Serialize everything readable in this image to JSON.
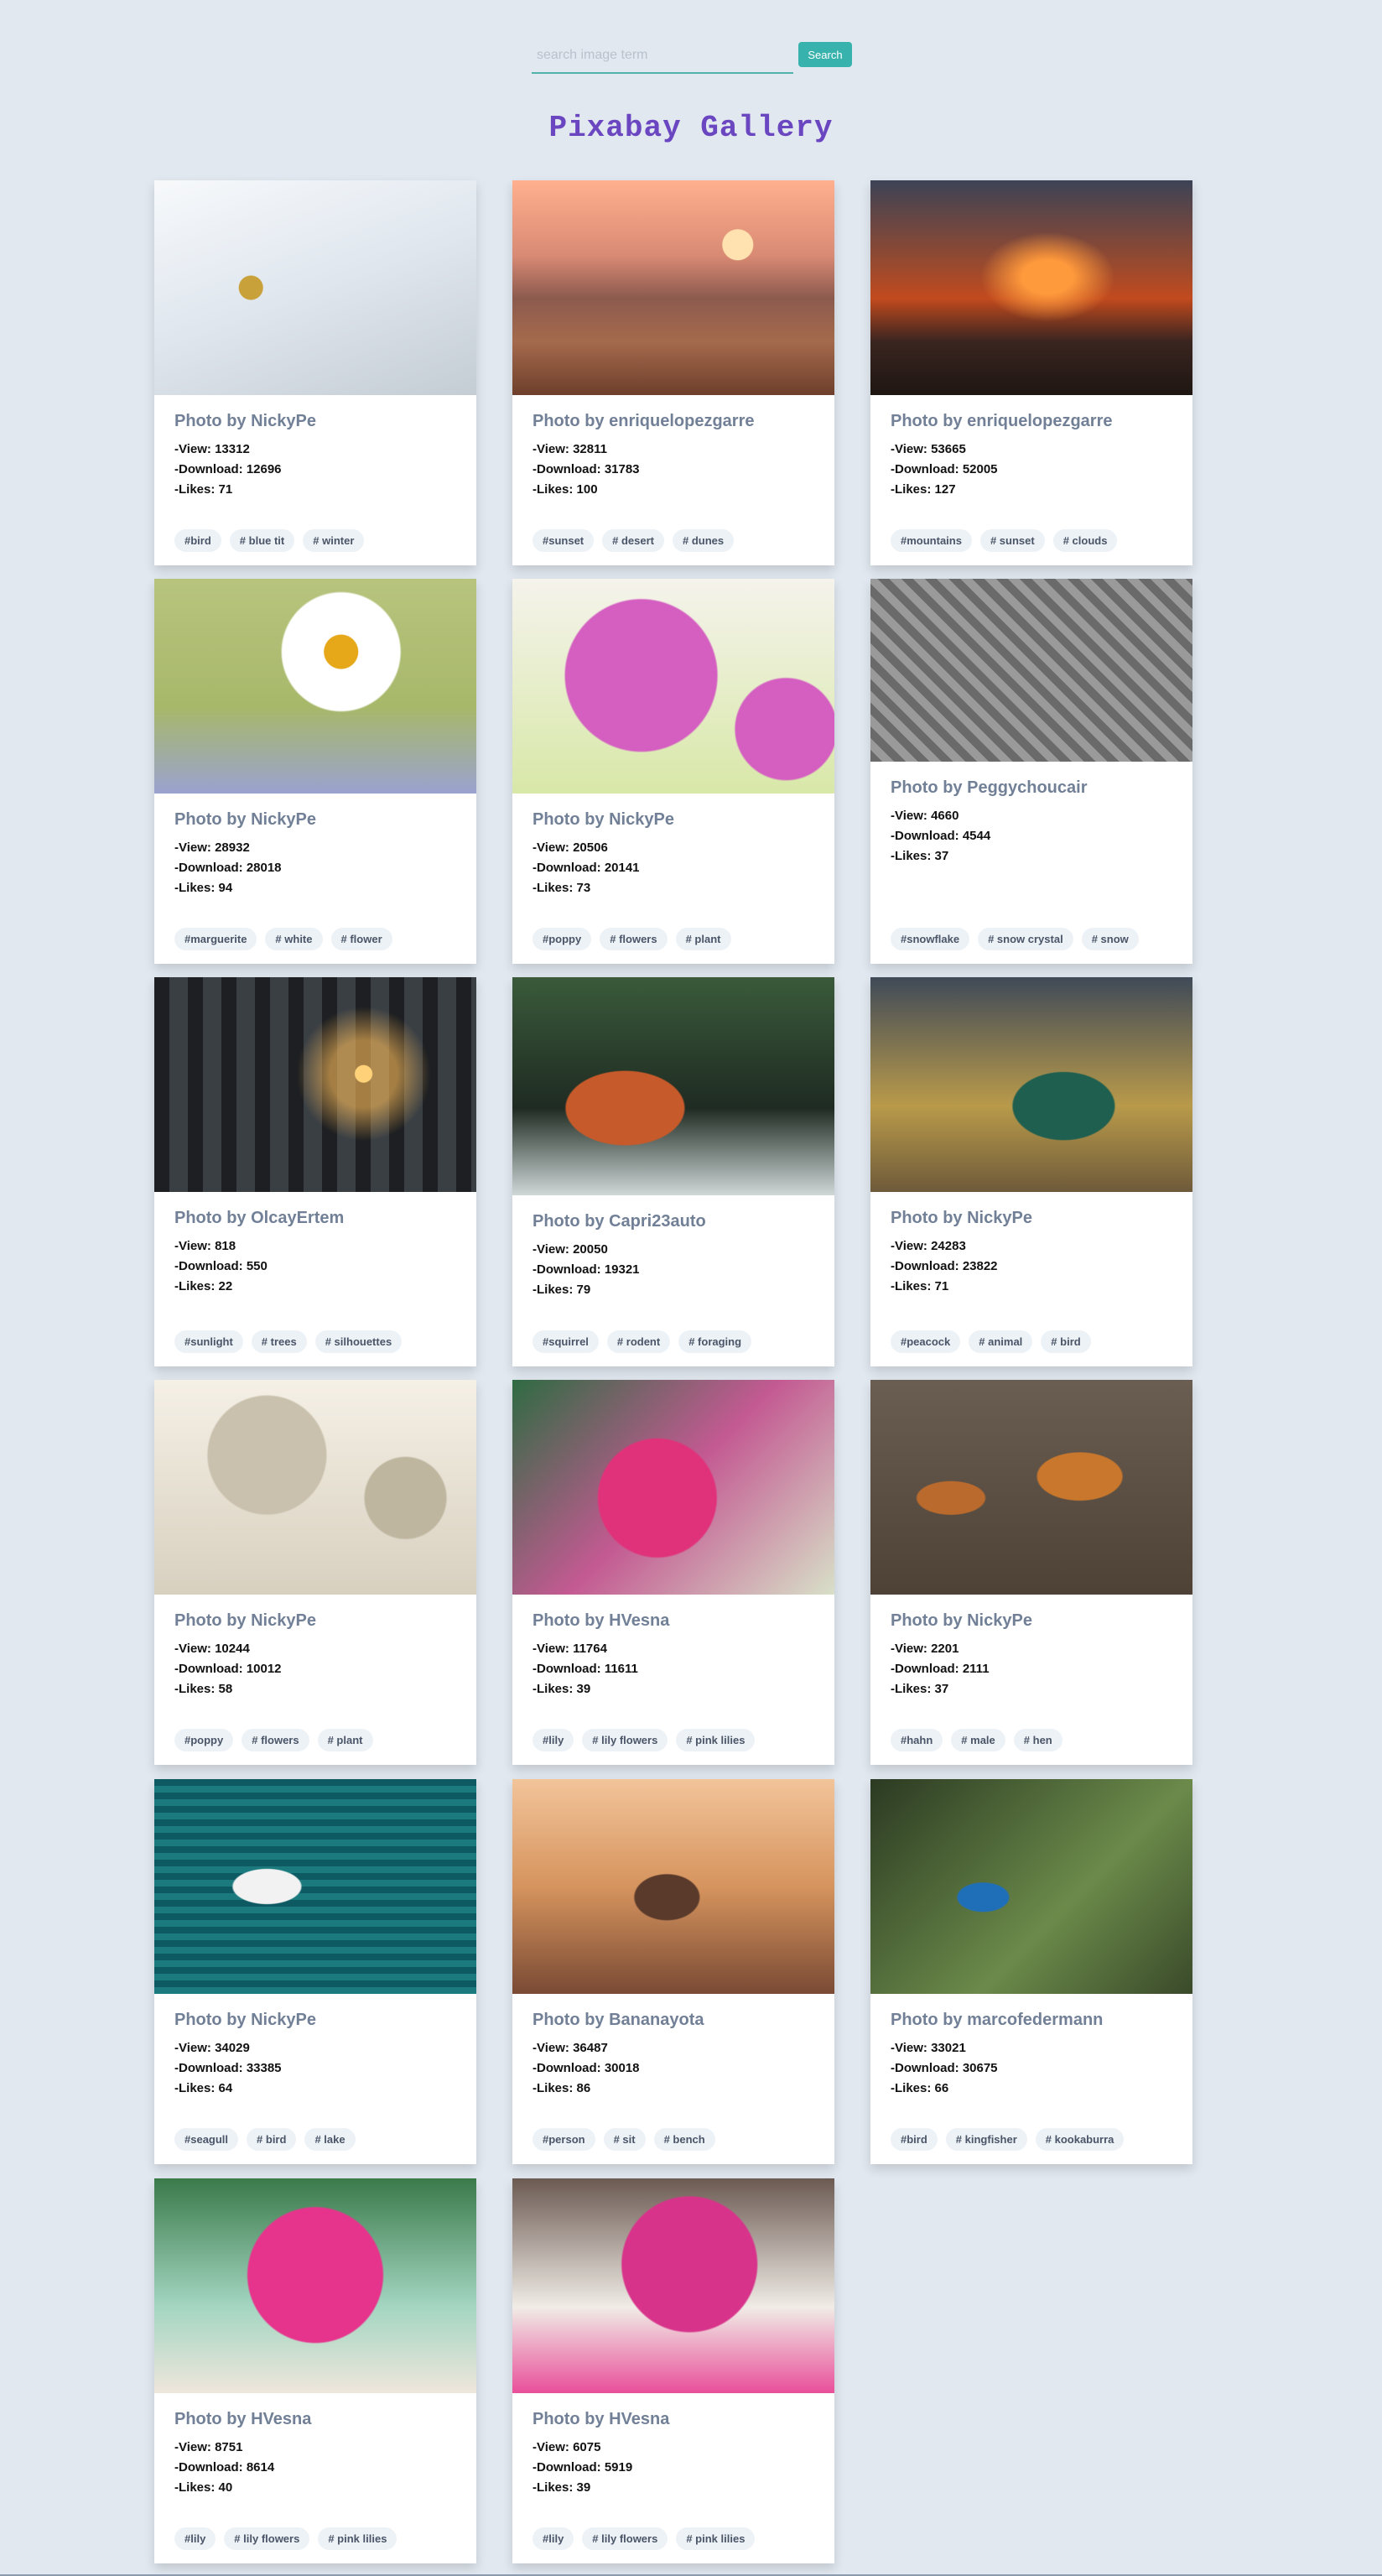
{
  "search": {
    "placeholder": "search image term",
    "button_label": "Search"
  },
  "title": "Pixabay Gallery",
  "colors": {
    "accent": "#38b2ac",
    "title": "#6b46c1",
    "background": "#e2e8f0"
  },
  "cards": [
    {
      "author": "Photo by NickyPe",
      "views": "-View: 13312",
      "downloads": "-Download: 12696",
      "likes": "-Likes: 71",
      "tags": [
        "#bird",
        "# blue tit",
        "# winter"
      ],
      "image": "bird-in-snowy-branches"
    },
    {
      "author": "Photo by enriquelopezgarre",
      "views": "-View: 32811",
      "downloads": "-Download: 31783",
      "likes": "-Likes: 100",
      "tags": [
        "#sunset",
        "# desert",
        "# dunes"
      ],
      "image": "desert-sunset"
    },
    {
      "author": "Photo by enriquelopezgarre",
      "views": "-View: 53665",
      "downloads": "-Download: 52005",
      "likes": "-Likes: 127",
      "tags": [
        "#mountains",
        "# sunset",
        "# clouds"
      ],
      "image": "mountain-sunset"
    },
    {
      "author": "Photo by NickyPe",
      "views": "-View: 28932",
      "downloads": "-Download: 28018",
      "likes": "-Likes: 94",
      "tags": [
        "#marguerite",
        "# white",
        "# flower"
      ],
      "image": "white-daisy"
    },
    {
      "author": "Photo by NickyPe",
      "views": "-View: 20506",
      "downloads": "-Download: 20141",
      "likes": "-Likes: 73",
      "tags": [
        "#poppy",
        "# flowers",
        "# plant"
      ],
      "image": "pink-poppies"
    },
    {
      "author": "Photo by Peggychoucair",
      "views": "-View: 4660",
      "downloads": "-Download: 4544",
      "likes": "-Likes: 37",
      "tags": [
        "#snowflake",
        "# snow crystal",
        "# snow"
      ],
      "image": "snowflake-on-knit"
    },
    {
      "author": "Photo by OlcayErtem",
      "views": "-View: 818",
      "downloads": "-Download: 550",
      "likes": "-Likes: 22",
      "tags": [
        "#sunlight",
        "# trees",
        "# silhouettes"
      ],
      "image": "forest-sunlight"
    },
    {
      "author": "Photo by Capri23auto",
      "views": "-View: 20050",
      "downloads": "-Download: 19321",
      "likes": "-Likes: 79",
      "tags": [
        "#squirrel",
        "# rodent",
        "# foraging"
      ],
      "image": "red-squirrel"
    },
    {
      "author": "Photo by NickyPe",
      "views": "-View: 24283",
      "downloads": "-Download: 23822",
      "likes": "-Likes: 71",
      "tags": [
        "#peacock",
        "# animal",
        "# bird"
      ],
      "image": "peacock"
    },
    {
      "author": "Photo by NickyPe",
      "views": "-View: 10244",
      "downloads": "-Download: 10012",
      "likes": "-Likes: 58",
      "tags": [
        "#poppy",
        "# flowers",
        "# plant"
      ],
      "image": "sepia-poppies"
    },
    {
      "author": "Photo by HVesna",
      "views": "-View: 11764",
      "downloads": "-Download: 11611",
      "likes": "-Likes: 39",
      "tags": [
        "#lily",
        "# lily flowers",
        "# pink lilies"
      ],
      "image": "pink-lily"
    },
    {
      "author": "Photo by NickyPe",
      "views": "-View: 2201",
      "downloads": "-Download: 2111",
      "likes": "-Likes: 37",
      "tags": [
        "#hahn",
        "# male",
        "# hen"
      ],
      "image": "rooster-and-hen"
    },
    {
      "author": "Photo by NickyPe",
      "views": "-View: 34029",
      "downloads": "-Download: 33385",
      "likes": "-Likes: 64",
      "tags": [
        "#seagull",
        "# bird",
        "# lake"
      ],
      "image": "seagull-on-lake"
    },
    {
      "author": "Photo by Bananayota",
      "views": "-View: 36487",
      "downloads": "-Download: 30018",
      "likes": "-Likes: 86",
      "tags": [
        "#person",
        "# sit",
        "# bench"
      ],
      "image": "person-on-bench"
    },
    {
      "author": "Photo by marcofedermann",
      "views": "-View: 33021",
      "downloads": "-Download: 30675",
      "likes": "-Likes: 66",
      "tags": [
        "#bird",
        "# kingfisher",
        "# kookaburra"
      ],
      "image": "kingfisher"
    },
    {
      "author": "Photo by HVesna",
      "views": "-View: 8751",
      "downloads": "-Download: 8614",
      "likes": "-Likes: 40",
      "tags": [
        "#lily",
        "# lily flowers",
        "# pink lilies"
      ],
      "image": "lily-bouquet"
    },
    {
      "author": "Photo by HVesna",
      "views": "-View: 6075",
      "downloads": "-Download: 5919",
      "likes": "-Likes: 39",
      "tags": [
        "#lily",
        "# lily flowers",
        "# pink lilies"
      ],
      "image": "pink-lilies-box"
    }
  ]
}
